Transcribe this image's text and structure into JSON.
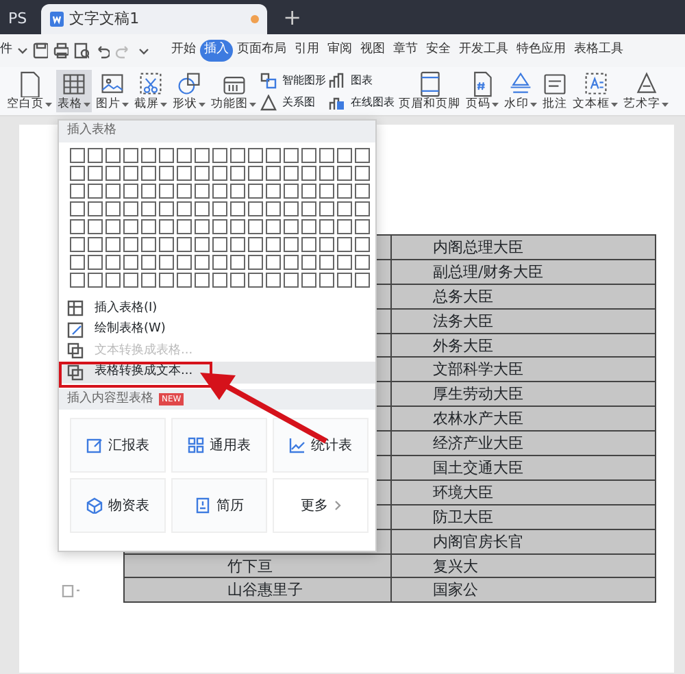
{
  "tabs": [
    {
      "label": "PS",
      "selected": false,
      "modified": false
    },
    {
      "label": "文字文稿1",
      "selected": true,
      "modified": true
    }
  ],
  "new_tab": "+",
  "menu": {
    "file": "件",
    "items": [
      {
        "label": "开始",
        "selected": false
      },
      {
        "label": "插入",
        "selected": true
      },
      {
        "label": "页面布局",
        "selected": false
      },
      {
        "label": "引用",
        "selected": false
      },
      {
        "label": "审阅",
        "selected": false
      },
      {
        "label": "视图",
        "selected": false
      },
      {
        "label": "章节",
        "selected": false
      },
      {
        "label": "安全",
        "selected": false
      },
      {
        "label": "开发工具",
        "selected": false
      },
      {
        "label": "特色应用",
        "selected": false
      },
      {
        "label": "表格工具",
        "selected": false
      }
    ]
  },
  "ribbon": [
    {
      "kind": "large",
      "label": "空白页",
      "dropdown": true,
      "pressed": false
    },
    {
      "kind": "large",
      "label": "表格",
      "dropdown": true,
      "pressed": true
    },
    {
      "kind": "large",
      "label": "图片",
      "dropdown": true,
      "pressed": false
    },
    {
      "kind": "large",
      "label": "截屏",
      "dropdown": true,
      "pressed": false
    },
    {
      "kind": "large",
      "label": "形状",
      "dropdown": true,
      "pressed": false
    },
    {
      "kind": "large",
      "label": "功能图",
      "dropdown": true,
      "pressed": false
    },
    {
      "kind": "pair",
      "items": [
        {
          "label": "智能图形"
        },
        {
          "label": "关系图"
        }
      ]
    },
    {
      "kind": "pair",
      "items": [
        {
          "label": "图表"
        },
        {
          "label": "在线图表"
        }
      ]
    },
    {
      "kind": "large",
      "label": "页眉和页脚",
      "dropdown": false,
      "pressed": false
    },
    {
      "kind": "large",
      "label": "页码",
      "dropdown": true,
      "pressed": false
    },
    {
      "kind": "large",
      "label": "水印",
      "dropdown": true,
      "pressed": false
    },
    {
      "kind": "large",
      "label": "批注",
      "dropdown": false,
      "pressed": false
    },
    {
      "kind": "large",
      "label": "文本框",
      "dropdown": true,
      "pressed": false
    },
    {
      "kind": "large",
      "label": "艺术字",
      "dropdown": true,
      "pressed": false
    }
  ],
  "table_menu": {
    "title": "插入表格",
    "items": [
      {
        "label": "插入表格(I)",
        "disabled": false,
        "highlighted": false
      },
      {
        "label": "绘制表格(W)",
        "disabled": false,
        "highlighted": false
      },
      {
        "label": "文本转换成表格...",
        "disabled": true,
        "highlighted": false
      },
      {
        "label": "表格转换成文本...",
        "disabled": false,
        "highlighted": true
      }
    ],
    "content_section": {
      "title": "插入内容型表格",
      "badge": "NEW",
      "cards": [
        {
          "kind": "template",
          "label": "汇报表"
        },
        {
          "kind": "template",
          "label": "通用表"
        },
        {
          "kind": "template",
          "label": "统计表"
        },
        {
          "kind": "template",
          "label": "物资表"
        },
        {
          "kind": "template",
          "label": "简历"
        },
        {
          "kind": "more",
          "label": "更多"
        }
      ]
    }
  },
  "document": {
    "rows": [
      {
        "column_2": "内阁总理大臣"
      },
      {
        "column_2": "副总理/财务大臣"
      },
      {
        "column_2": "总务大臣"
      },
      {
        "column_2": "法务大臣"
      },
      {
        "column_2": "外务大臣"
      },
      {
        "column_2": "文部科学大臣"
      },
      {
        "column_2": "厚生劳动大臣"
      },
      {
        "column_2": "农林水产大臣"
      },
      {
        "column_2": "经济产业大臣"
      },
      {
        "column_2": "国土交通大臣"
      },
      {
        "column_2": "环境大臣"
      },
      {
        "column_2": "防卫大臣"
      },
      {
        "column_2": "内阁官房长官"
      },
      {
        "column_1": "竹下亘",
        "column_2": "复兴大"
      },
      {
        "column_1": "山谷惠里子",
        "column_2": "国家公"
      }
    ]
  }
}
